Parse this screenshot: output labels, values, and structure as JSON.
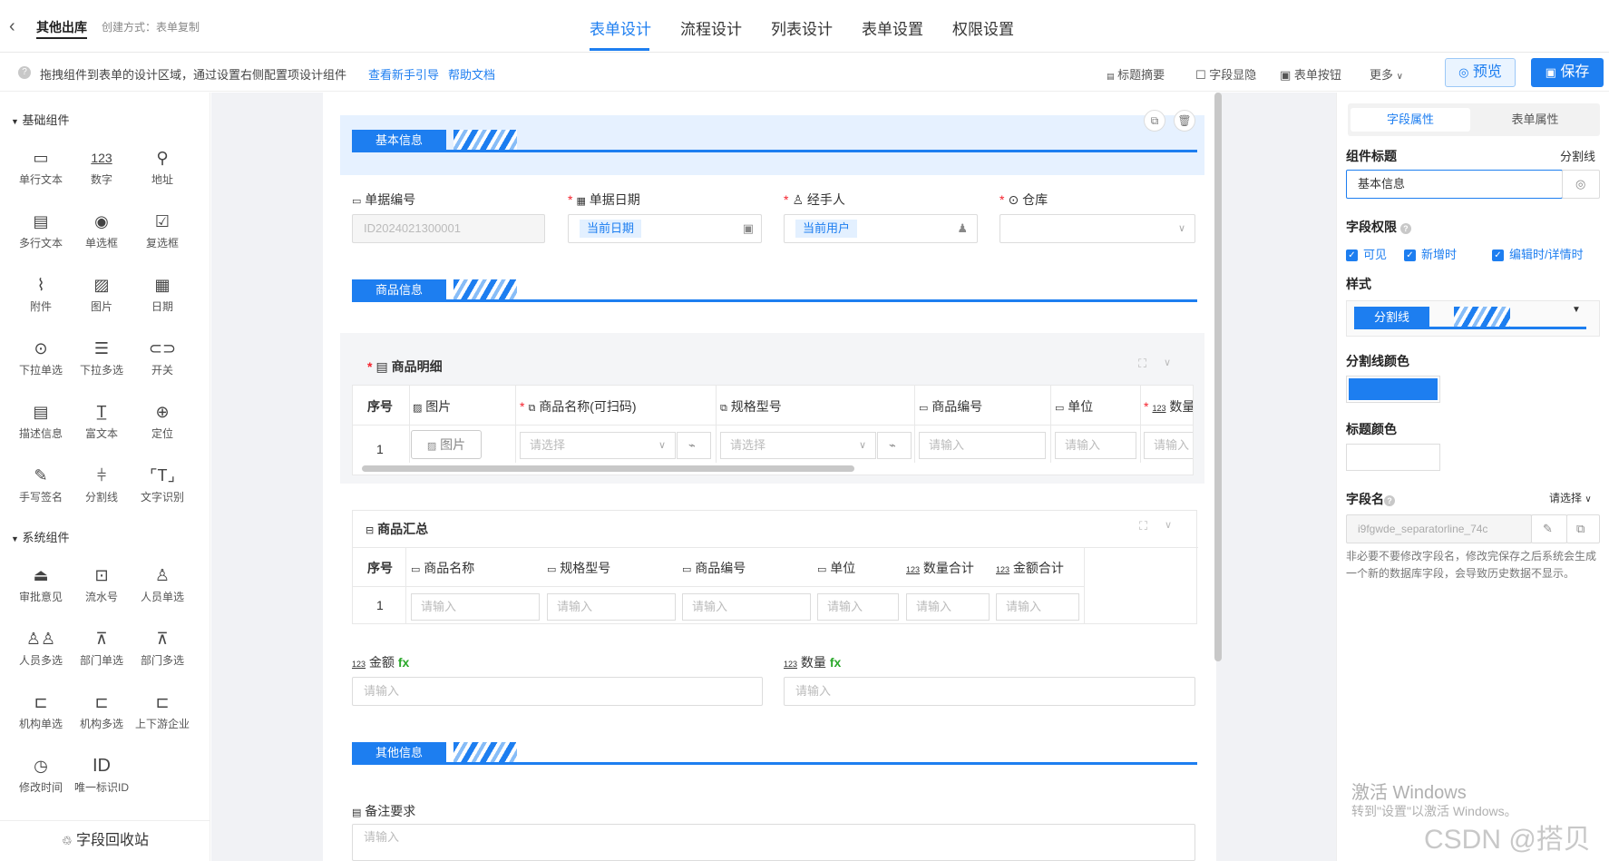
{
  "header": {
    "back_icon": "chevron-left-icon",
    "title": "其他出库",
    "method": "创建方式：表单复制",
    "tabs": [
      "表单设计",
      "流程设计",
      "列表设计",
      "表单设置",
      "权限设置"
    ],
    "active_tab": "表单设计"
  },
  "hint": {
    "text": "拖拽组件到表单的设计区域，通过设置右侧配置项设计组件",
    "link1": "查看新手引导",
    "link2": "帮助文档",
    "tools": [
      "标题摘要",
      "字段显隐",
      "表单按钮",
      "更多"
    ],
    "preview": "预览",
    "save": "保存"
  },
  "palette": {
    "basic_title": "基础组件",
    "basic": [
      "单行文本",
      "数字",
      "地址",
      "多行文本",
      "单选框",
      "复选框",
      "附件",
      "图片",
      "日期",
      "下拉单选",
      "下拉多选",
      "开关",
      "描述信息",
      "富文本",
      "定位",
      "手写签名",
      "分割线",
      "文字识别"
    ],
    "system_title": "系统组件",
    "system": [
      "审批意见",
      "流水号",
      "人员单选",
      "人员多选",
      "部门单选",
      "部门多选",
      "机构单选",
      "机构多选",
      "上下游企业",
      "修改时间",
      "唯一标识ID"
    ],
    "recycle": "字段回收站"
  },
  "form": {
    "section1": "基本信息",
    "f_no_label": "单据编号",
    "f_no_value": "ID2024021300001",
    "f_date_label": "单据日期",
    "f_date_value": "当前日期",
    "f_user_label": "经手人",
    "f_user_value": "当前用户",
    "f_wh_label": "仓库",
    "section2": "商品信息",
    "detail_title": "商品明细",
    "detail_cols": [
      "序号",
      "图片",
      "商品名称(可扫码)",
      "规格型号",
      "商品编号",
      "单位",
      "数量"
    ],
    "detail_row_no": "1",
    "img_btn": "图片",
    "select_ph": "请选择",
    "input_ph": "请输入",
    "summary_title": "商品汇总",
    "summary_cols": [
      "序号",
      "商品名称",
      "规格型号",
      "商品编号",
      "单位",
      "数量合计",
      "金额合计"
    ],
    "summary_row_no": "1",
    "amount_label": "金额",
    "qty_label": "数量",
    "fx": "fx",
    "section3": "其他信息",
    "remark_label": "备注要求"
  },
  "right": {
    "tab1": "字段属性",
    "tab2": "表单属性",
    "comp_title_label": "组件标题",
    "comp_title_right": "分割线",
    "comp_title_value": "基本信息",
    "perm_label": "字段权限",
    "perm_opts": [
      "可见",
      "新增时",
      "编辑时/详情时"
    ],
    "style_label": "样式",
    "style_value": "分割线",
    "line_color_label": "分割线颜色",
    "line_color": "#1d7ef0",
    "title_color_label": "标题颜色",
    "field_name_label": "字段名",
    "field_name_right": "请选择",
    "field_name_value": "i9fgwde_separatorline_74c",
    "note": "非必要不要修改字段名，修改完保存之后系统会生成一个新的数据库字段，会导致历史数据不显示。"
  },
  "watermark": {
    "win1": "激活 Windows",
    "win2": "转到\"设置\"以激活 Windows。",
    "csdn": "CSDN @搭贝"
  }
}
